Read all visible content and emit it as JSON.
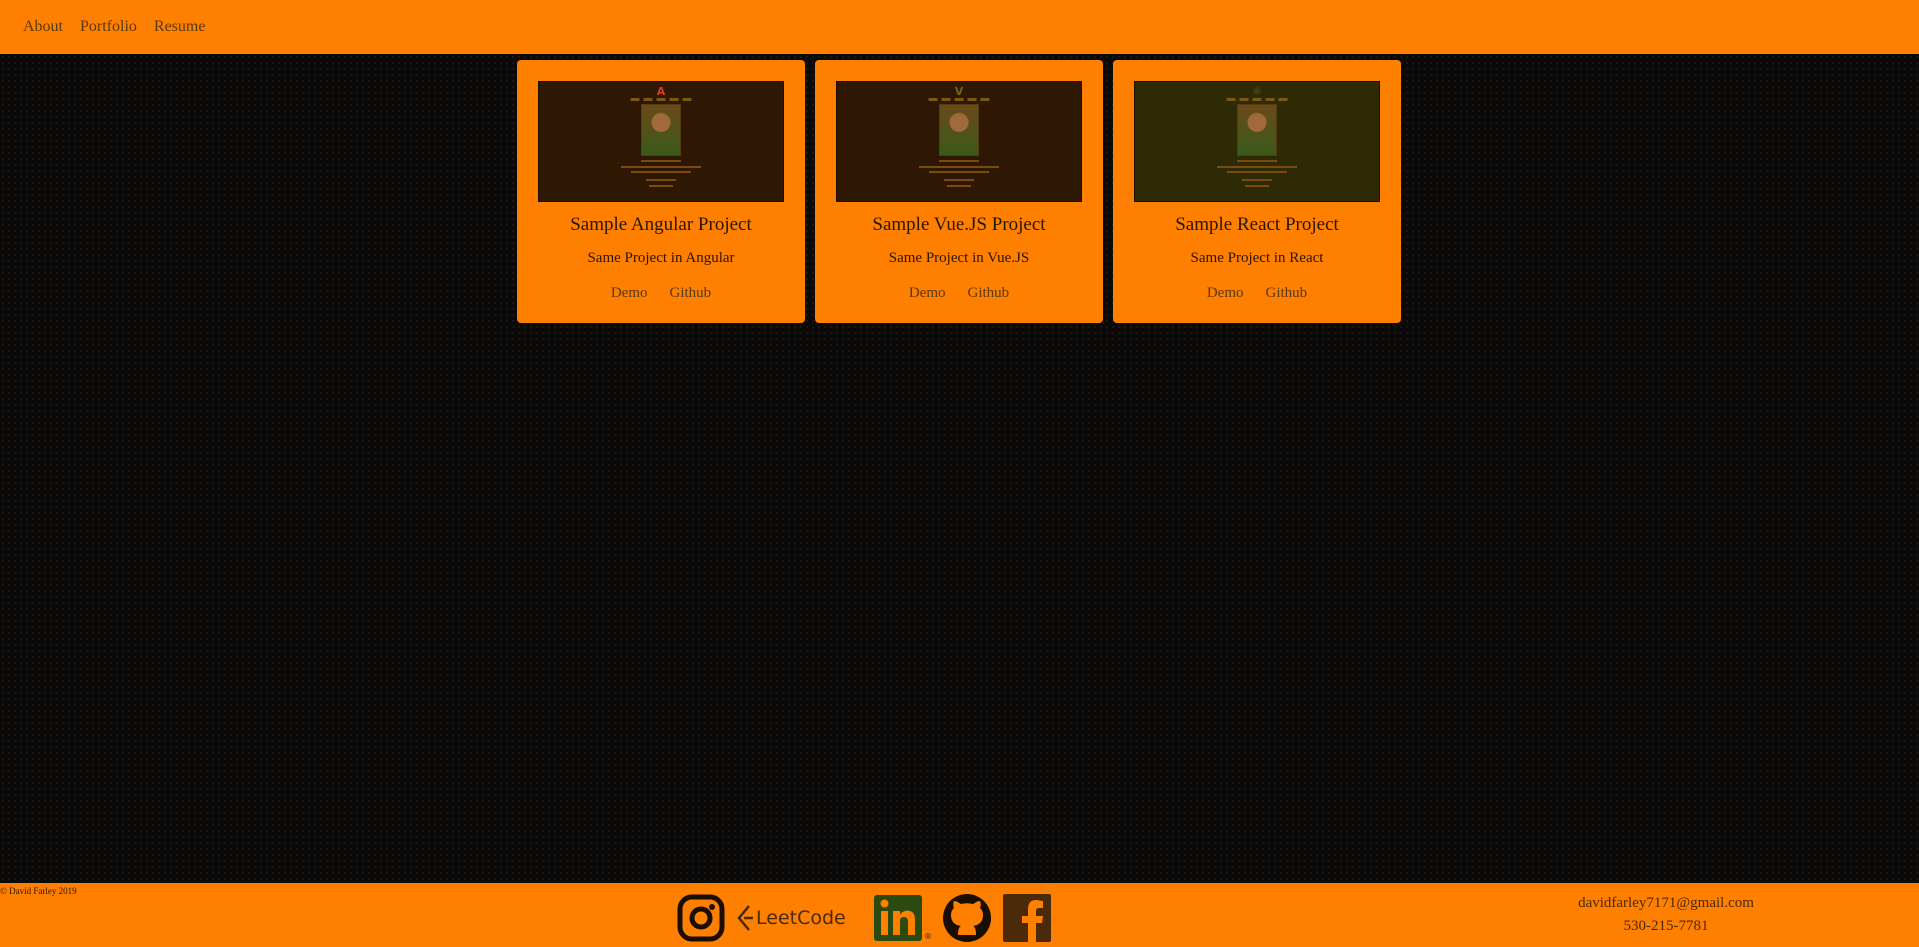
{
  "nav": {
    "items": [
      {
        "label": "About"
      },
      {
        "label": "Portfolio"
      },
      {
        "label": "Resume"
      }
    ]
  },
  "projects": [
    {
      "title": "Sample Angular Project",
      "description": "Same Project in Angular",
      "demo": "Demo",
      "github": "Github",
      "logo_icon": "angular-icon"
    },
    {
      "title": "Sample Vue.JS Project",
      "description": "Same Project in Vue.JS",
      "demo": "Demo",
      "github": "Github",
      "logo_icon": "vue-icon"
    },
    {
      "title": "Sample React Project",
      "description": "Same Project in React",
      "demo": "Demo",
      "github": "Github",
      "logo_icon": "react-icon"
    }
  ],
  "footer": {
    "copyright": "© David Farley 2019",
    "socials": [
      {
        "icon": "instagram-icon"
      },
      {
        "icon": "leetcode-icon",
        "label": "LeetCode"
      },
      {
        "icon": "linkedin-icon"
      },
      {
        "icon": "github-icon"
      },
      {
        "icon": "facebook-icon"
      }
    ],
    "email": "davidfarley7171@gmail.com",
    "phone": "530-215-7781"
  },
  "colors": {
    "accent": "#ff7f00",
    "background": "#0a0a0a",
    "link": "#5a3a10"
  }
}
